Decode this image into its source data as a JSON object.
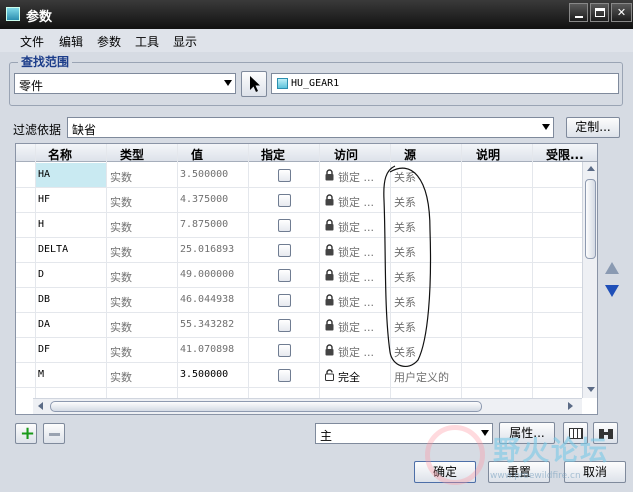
{
  "window": {
    "title": "参数"
  },
  "menu": [
    "文件",
    "编辑",
    "参数",
    "工具",
    "显示"
  ],
  "lookin": {
    "group_label": "查找范围",
    "type_value": "零件",
    "model_value": "HU_GEAR1"
  },
  "filter": {
    "label": "过滤依据",
    "value": "缺省",
    "customize_label": "定制..."
  },
  "table": {
    "columns": [
      "名称",
      "类型",
      "值",
      "指定",
      "访问",
      "源",
      "说明",
      "受限..."
    ],
    "rows": [
      {
        "name": "HA",
        "type": "实数",
        "value": "3.500000",
        "access": "锁定 ...",
        "source": "关系"
      },
      {
        "name": "HF",
        "type": "实数",
        "value": "4.375000",
        "access": "锁定 ...",
        "source": "关系"
      },
      {
        "name": "H",
        "type": "实数",
        "value": "7.875000",
        "access": "锁定 ...",
        "source": "关系"
      },
      {
        "name": "DELTA",
        "type": "实数",
        "value": "25.016893",
        "access": "锁定 ...",
        "source": "关系"
      },
      {
        "name": "D",
        "type": "实数",
        "value": "49.000000",
        "access": "锁定 ...",
        "source": "关系"
      },
      {
        "name": "DB",
        "type": "实数",
        "value": "46.044938",
        "access": "锁定 ...",
        "source": "关系"
      },
      {
        "name": "DA",
        "type": "实数",
        "value": "55.343282",
        "access": "锁定 ...",
        "source": "关系"
      },
      {
        "name": "DF",
        "type": "实数",
        "value": "41.070898",
        "access": "锁定 ...",
        "source": "关系"
      },
      {
        "name": "M",
        "type": "实数",
        "value": "3.500000",
        "access": "完全",
        "source": "用户定义的"
      }
    ]
  },
  "bottom": {
    "main_select": "主",
    "properties_label": "属性...",
    "ok_label": "确定",
    "reset_label": "重置",
    "cancel_label": "取消"
  },
  "watermark": {
    "text": "野火论坛",
    "url": "www.proewildfire.cn"
  }
}
